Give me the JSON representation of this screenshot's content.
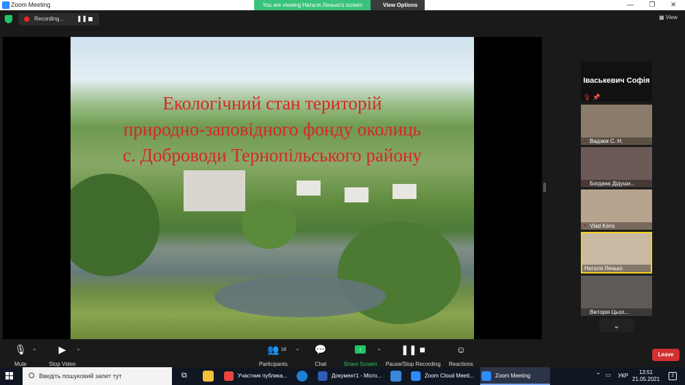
{
  "window": {
    "title": "Zoom Meeting",
    "minimize": "—",
    "maximize": "❐",
    "close": "✕"
  },
  "banner": {
    "text": "You are viewing Наталя Ленько's screen",
    "view_options": "View Options"
  },
  "recording": {
    "label": "Recording...",
    "pause": "❚❚"
  },
  "view_button": "View",
  "slide": {
    "title_lines": [
      "Екологічний стан територій",
      "природно-заповідного фонду  околиць",
      "с. Доброводи   Тернопільського району"
    ]
  },
  "speaker": {
    "name": "Іваськевич  Софія"
  },
  "participants_tiles": [
    {
      "name": "Вадзюк С. Н.",
      "bg": "#8a7b6a"
    },
    {
      "name": "Богдана Дідуши...",
      "bg": "#6b5a55"
    },
    {
      "name": "Vlad Kens",
      "bg": "#b7a48f"
    },
    {
      "name": "Наталя Ленько",
      "bg": "#c9b8a2"
    },
    {
      "name": "Вікторія Цьол...",
      "bg": "#5d5a57"
    }
  ],
  "toolbar": {
    "mute": "Mute",
    "stop_video": "Stop Video",
    "participants": "Participants",
    "participants_count": "18",
    "chat": "Chat",
    "share_screen": "Share Screen",
    "pause_stop_recording": "Pause/Stop Recording",
    "reactions": "Reactions",
    "leave": "Leave"
  },
  "taskbar": {
    "search_placeholder": "Введіть пошуковий запит тут",
    "apps": [
      {
        "label": "Участник публика...",
        "color": "#e8453c"
      },
      {
        "label": "Документ1 - Micro...",
        "color": "#2b5cb8"
      },
      {
        "label": "Zoom Cloud Meeti...",
        "color": "#2D8CFF"
      },
      {
        "label": "Zoom Meeting",
        "color": "#2D8CFF"
      }
    ],
    "language": "УКР",
    "time": "13:51",
    "date": "21.05.2021",
    "notifications": "2"
  },
  "colors": {
    "accent": "#2D8CFF",
    "share_green": "#1ec765",
    "leave_red": "#d32f2f",
    "active_speaker": "#f5d21a",
    "slide_title": "#d8252a"
  }
}
